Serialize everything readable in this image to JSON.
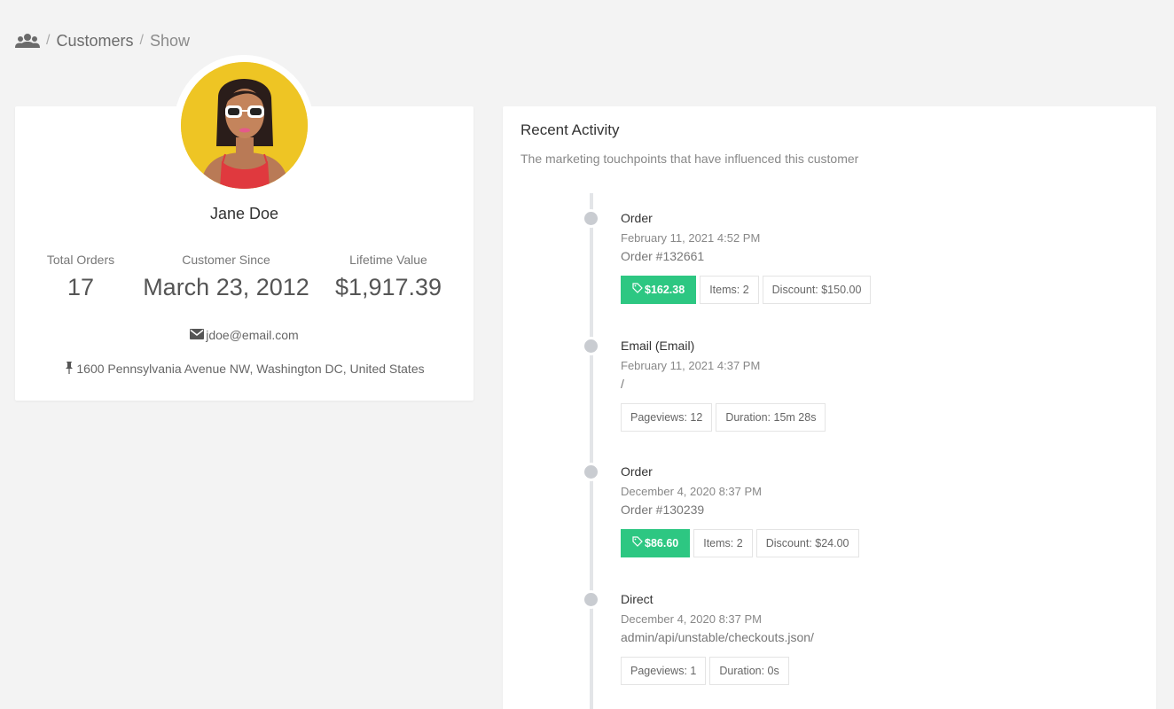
{
  "breadcrumb": {
    "icon": "users-icon",
    "items": [
      "Customers",
      "Show"
    ],
    "separator": "/"
  },
  "customer": {
    "name": "Jane Doe",
    "stats": {
      "total_orders_label": "Total Orders",
      "total_orders_value": "17",
      "since_label": "Customer Since",
      "since_value": "March 23, 2012",
      "ltv_label": "Lifetime Value",
      "ltv_value": "$1,917.39"
    },
    "email": "jdoe@email.com",
    "address": "1600 Pennsylvania Avenue NW, Washington DC, United States"
  },
  "activity": {
    "title": "Recent Activity",
    "subtitle": "The marketing touchpoints that have influenced this customer",
    "items": [
      {
        "title": "Order",
        "date": "February 11, 2021 4:52 PM",
        "detail": "Order #132661",
        "price": "$162.38",
        "tags": [
          "Items: 2",
          "Discount: $150.00"
        ]
      },
      {
        "title": "Email (Email)",
        "date": "February 11, 2021 4:37 PM",
        "detail": "/",
        "tags": [
          "Pageviews: 12",
          "Duration: 15m 28s"
        ]
      },
      {
        "title": "Order",
        "date": "December 4, 2020 8:37 PM",
        "detail": "Order #130239",
        "price": "$86.60",
        "tags": [
          "Items: 2",
          "Discount: $24.00"
        ]
      },
      {
        "title": "Direct",
        "date": "December 4, 2020 8:37 PM",
        "detail": "admin/api/unstable/checkouts.json/",
        "tags": [
          "Pageviews: 1",
          "Duration: 0s"
        ]
      }
    ]
  },
  "colors": {
    "background": "#f3f3f3",
    "card": "#ffffff",
    "accent_green": "#2dc782",
    "timeline": "#e3e5e8",
    "avatar_bg": "#eec524"
  }
}
